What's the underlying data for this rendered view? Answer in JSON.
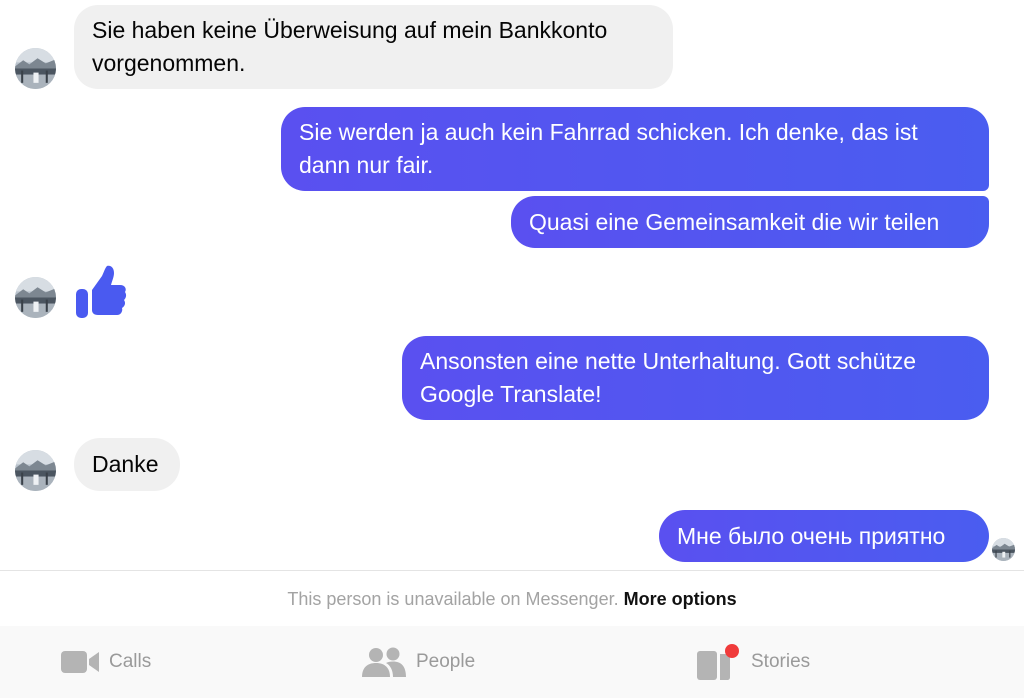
{
  "messages": [
    {
      "sender": "them",
      "text": "Sie haben keine Überweisung auf mein Bankkonto\nvorgenommen."
    },
    {
      "sender": "me",
      "text": "Sie werden ja auch kein Fahrrad schicken. Ich denke, das ist\ndann nur fair."
    },
    {
      "sender": "me",
      "text": "Quasi eine Gemeinsamkeit die wir teilen"
    },
    {
      "sender": "them",
      "type": "like-sticker",
      "icon": "thumbs-up-icon"
    },
    {
      "sender": "me",
      "text": "Ansonsten eine nette Unterhaltung. Gott schütze\nGoogle Translate!"
    },
    {
      "sender": "them",
      "text": "Danke"
    },
    {
      "sender": "me",
      "text": "Мне было очень приятно"
    }
  ],
  "notice": {
    "text": "This person is unavailable on Messenger.",
    "action": "More options"
  },
  "tabs": [
    {
      "label": "Calls",
      "icon": "video-camera-icon"
    },
    {
      "label": "People",
      "icon": "people-icon"
    },
    {
      "label": "Stories",
      "icon": "stories-icon",
      "badge": true
    }
  ],
  "colors": {
    "outgoing_bubble": "#5a50f0",
    "incoming_bubble": "#f0f0f0",
    "like": "#4a5af0",
    "badge": "#f03b3b"
  }
}
